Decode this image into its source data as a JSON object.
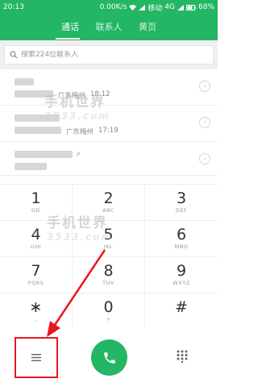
{
  "status_bar": {
    "time": "20:13",
    "net_speed": "0.00K/s",
    "carrier": "移动",
    "network": "4G",
    "battery": "68%"
  },
  "tabs": [
    {
      "label": "通话",
      "active": true
    },
    {
      "label": "联系人",
      "active": false
    },
    {
      "label": "黄页",
      "active": false
    }
  ],
  "search": {
    "placeholder": "搜索224位联系人"
  },
  "calls": [
    {
      "location": "广东梅州",
      "time": "18:12"
    },
    {
      "location": "广东梅州",
      "time": "17:19"
    },
    {
      "location": "",
      "time": ""
    }
  ],
  "keypad": [
    {
      "digit": "1",
      "letters": "GD"
    },
    {
      "digit": "2",
      "letters": "ABC"
    },
    {
      "digit": "3",
      "letters": "DEF"
    },
    {
      "digit": "4",
      "letters": "GHI"
    },
    {
      "digit": "5",
      "letters": "JKL"
    },
    {
      "digit": "6",
      "letters": "MNO"
    },
    {
      "digit": "7",
      "letters": "PQRS"
    },
    {
      "digit": "8",
      "letters": "TUV"
    },
    {
      "digit": "9",
      "letters": "WXYZ"
    },
    {
      "digit": "∗",
      "letters": ","
    },
    {
      "digit": "0",
      "letters": "+"
    },
    {
      "digit": "#",
      "letters": ""
    }
  ],
  "watermark": {
    "text": "手机世界",
    "sub": "3533.com"
  },
  "colors": {
    "accent": "#23b665",
    "highlight": "#e8161f"
  },
  "icons": {
    "search": "search-icon",
    "menu": "menu-icon",
    "call": "phone-icon",
    "dialpad": "dialpad-icon"
  }
}
